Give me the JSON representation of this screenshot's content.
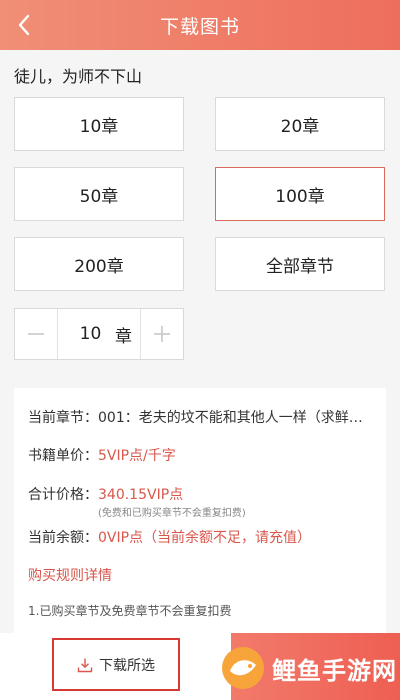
{
  "header": {
    "title": "下载图书",
    "back_icon": "chevron-left-icon"
  },
  "book": {
    "title": "徒儿，为师不下山"
  },
  "options": [
    "10章",
    "20章",
    "50章",
    "100章",
    "200章",
    "全部章节"
  ],
  "selected_option": "100章",
  "stepper": {
    "value": "10",
    "unit": "章"
  },
  "info": {
    "chapter_label": "当前章节：",
    "chapter_value": "001：老夫的坟不能和其他人一样（求鲜…",
    "price_label": "书籍单价：",
    "price_value": "5VIP点/千字",
    "total_label": "合计价格：",
    "total_value": "340.15VIP点",
    "total_note": "(免费和已购买章节不会重复扣费)",
    "balance_label": "当前余额：",
    "balance_value": "0VIP点（当前余额不足，请充值）",
    "rules_link": "购买规则详情",
    "tip": "1.已购买章节及免费章节不会重复扣费"
  },
  "bottom": {
    "download_label": "下载所选",
    "watermark": "鲤鱼手游网"
  },
  "colors": {
    "header": "#ee6e5c",
    "accent": "#d9574b",
    "border_highlight": "#d63a33"
  }
}
